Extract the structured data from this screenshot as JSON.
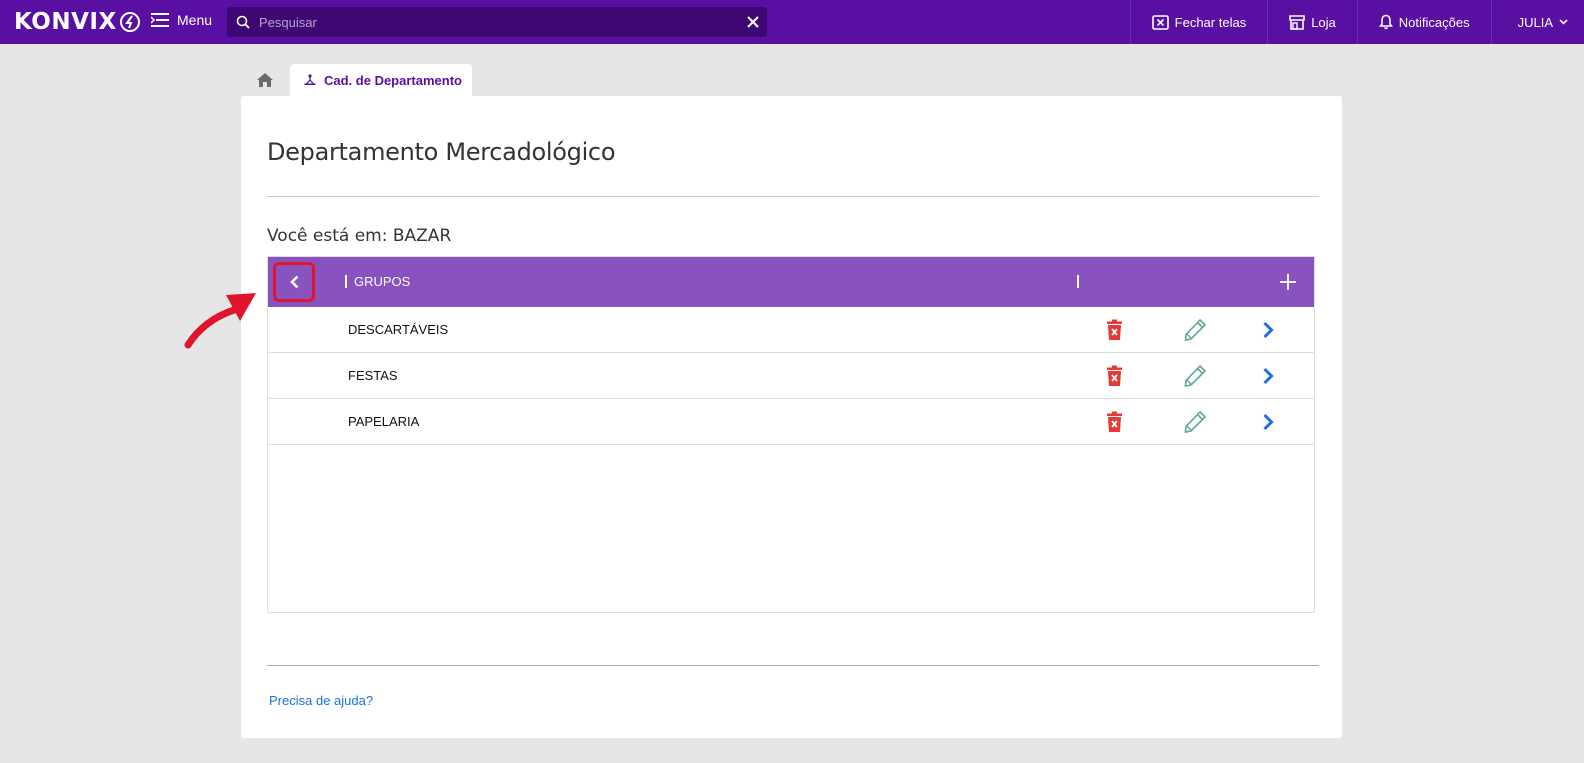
{
  "topbar": {
    "brand": "KONVIX",
    "menu_label": "Menu",
    "search_placeholder": "Pesquisar",
    "nav": {
      "close_screens": "Fechar telas",
      "store": "Loja",
      "notifications": "Notificações",
      "user": "JULIA"
    }
  },
  "tabs": {
    "active_label": "Cad. de Departamento"
  },
  "page": {
    "title": "Departamento Mercadológico",
    "location": "Você está em: BAZAR",
    "table_header": "GRUPOS",
    "rows": [
      {
        "name": "DESCARTÁVEIS"
      },
      {
        "name": "FESTAS"
      },
      {
        "name": "PAPELARIA"
      }
    ],
    "help_link": "Precisa de ajuda?"
  },
  "colors": {
    "topbar": "#5a0fa3",
    "table_header": "#8853bf",
    "delete": "#e53935",
    "edit": "#5fa88c",
    "forward": "#1e6fe0",
    "highlight": "#e0142b"
  }
}
